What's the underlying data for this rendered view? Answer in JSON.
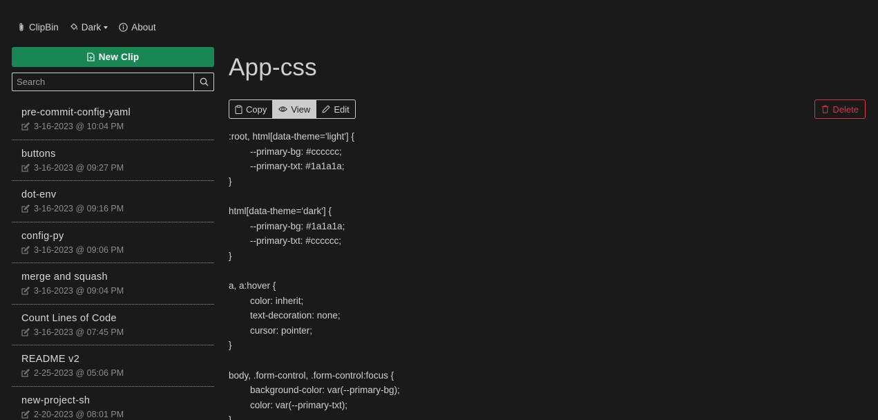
{
  "nav": {
    "brand": "ClipBin",
    "theme": "Dark",
    "about": "About"
  },
  "sidebar": {
    "new_clip": "New Clip",
    "search_placeholder": "Search",
    "clips": [
      {
        "title": "pre-commit-config-yaml",
        "date": "3-16-2023 @ 10:04 PM"
      },
      {
        "title": "buttons",
        "date": "3-16-2023 @ 09:27 PM"
      },
      {
        "title": "dot-env",
        "date": "3-16-2023 @ 09:16 PM"
      },
      {
        "title": "config-py",
        "date": "3-16-2023 @ 09:06 PM"
      },
      {
        "title": "merge and squash",
        "date": "3-16-2023 @ 09:04 PM"
      },
      {
        "title": "Count Lines of Code",
        "date": "3-16-2023 @ 07:45 PM"
      },
      {
        "title": "README v2",
        "date": "2-25-2023 @ 05:06 PM"
      },
      {
        "title": "new-project-sh",
        "date": "2-20-2023 @ 08:01 PM"
      }
    ]
  },
  "main": {
    "title": "App-css",
    "toolbar": {
      "copy": "Copy",
      "view": "View",
      "edit": "Edit"
    },
    "delete": "Delete",
    "code_lines": [
      ":root, html[data-theme='light'] {",
      "--primary-bg: #cccccc;",
      "--primary-txt: #1a1a1a;",
      "}",
      "",
      "html[data-theme='dark'] {",
      "--primary-bg: #1a1a1a;",
      "--primary-txt: #cccccc;",
      "}",
      "",
      "a, a:hover {",
      "color: inherit;",
      "text-decoration: none;",
      "cursor: pointer;",
      "}",
      "",
      "body, .form-control, .form-control:focus {",
      "background-color: var(--primary-bg);",
      "color: var(--primary-txt);",
      "}"
    ]
  },
  "colors": {
    "background": "#1a1a1a",
    "text": "#cccccc",
    "accent_green": "#198754",
    "danger": "#dc3545"
  }
}
